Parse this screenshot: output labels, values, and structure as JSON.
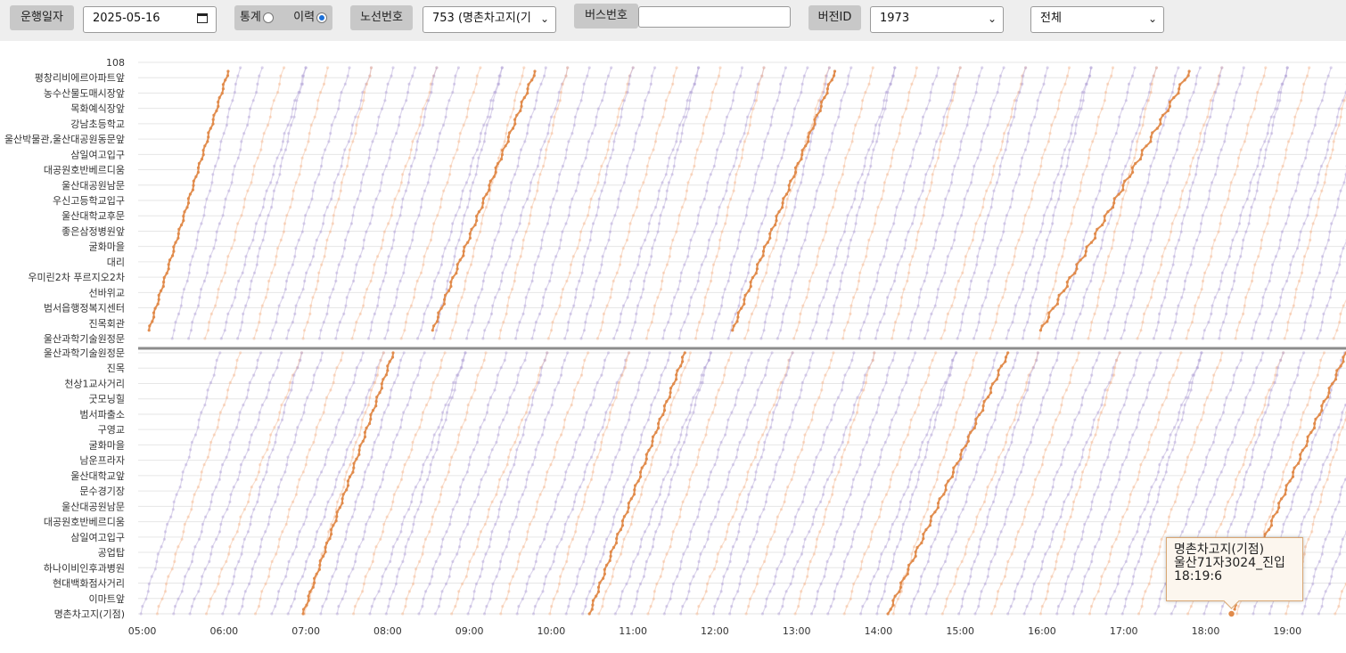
{
  "toolbar": {
    "date_label": "운행일자",
    "date_value": "2025-05-16",
    "stats_label": "통계",
    "history_label": "이력",
    "mode_selected": "이력",
    "route_label": "노선번호",
    "route_value": "753 (명촌차고지(기",
    "bus_label": "버스번호",
    "bus_value": "",
    "version_label": "버전ID",
    "version_value": "1973",
    "filter_value": "전체"
  },
  "tooltip": {
    "line1": "명촌차고지(기점)",
    "line2": "울산71자3024_진입",
    "line3": "18:19:6"
  },
  "colors": {
    "highlight": "#e08a4a",
    "trace_primary": "#b4a3d6",
    "trace_secondary": "#f4b993",
    "divider": "#8c8c8c",
    "grid": "#e6e6e6"
  },
  "chart_data": {
    "type": "line",
    "x_ticks": [
      "05:00",
      "06:00",
      "07:00",
      "08:00",
      "09:00",
      "10:00",
      "11:00",
      "12:00",
      "13:00",
      "14:00",
      "15:00",
      "16:00",
      "17:00",
      "18:00",
      "19:00"
    ],
    "xlim": [
      "04:57",
      "19:43"
    ],
    "upper_stops": [
      "108",
      "평창리비에르아파트앞",
      "농수산물도매시장앞",
      "목화예식장앞",
      "강남초등학교",
      "울산박물관,울산대공원동문앞",
      "삼일여고입구",
      "대공원호반베르디움",
      "울산대공원남문",
      "우신고등학교입구",
      "울산대학교후문",
      "좋은삼정병원앞",
      "굴화마을",
      "대리",
      "우미린2차 푸르지오2차",
      "선바위교",
      "범서읍행정복지센터",
      "진목회관",
      "울산과학기술원정문"
    ],
    "lower_stops": [
      "울산과학기술원정문",
      "진목",
      "천상1교사거리",
      "굿모닝힐",
      "범서파출소",
      "구영교",
      "굴화마을",
      "남운프라자",
      "울산대학교앞",
      "문수경기장",
      "울산대공원남문",
      "대공원호반베르디움",
      "삼일여고입구",
      "공업탑",
      "하나이비인후과병원",
      "현대백화점사거리",
      "이마트앞",
      "명촌차고지(기점)"
    ],
    "highlight_lower_trips": [
      {
        "start": "06:58",
        "end": "08:04"
      },
      {
        "start": "10:28",
        "end": "11:38"
      },
      {
        "start": "14:07",
        "end": "15:35"
      },
      {
        "start": "18:19",
        "end": "19:43"
      }
    ],
    "highlight_upper_trips": [
      {
        "start": "05:05",
        "end": "06:03"
      },
      {
        "start": "08:33",
        "end": "09:48"
      },
      {
        "start": "12:13",
        "end": "13:28"
      },
      {
        "start": "15:59",
        "end": "17:48"
      }
    ],
    "trace_interval_minutes": 12
  }
}
